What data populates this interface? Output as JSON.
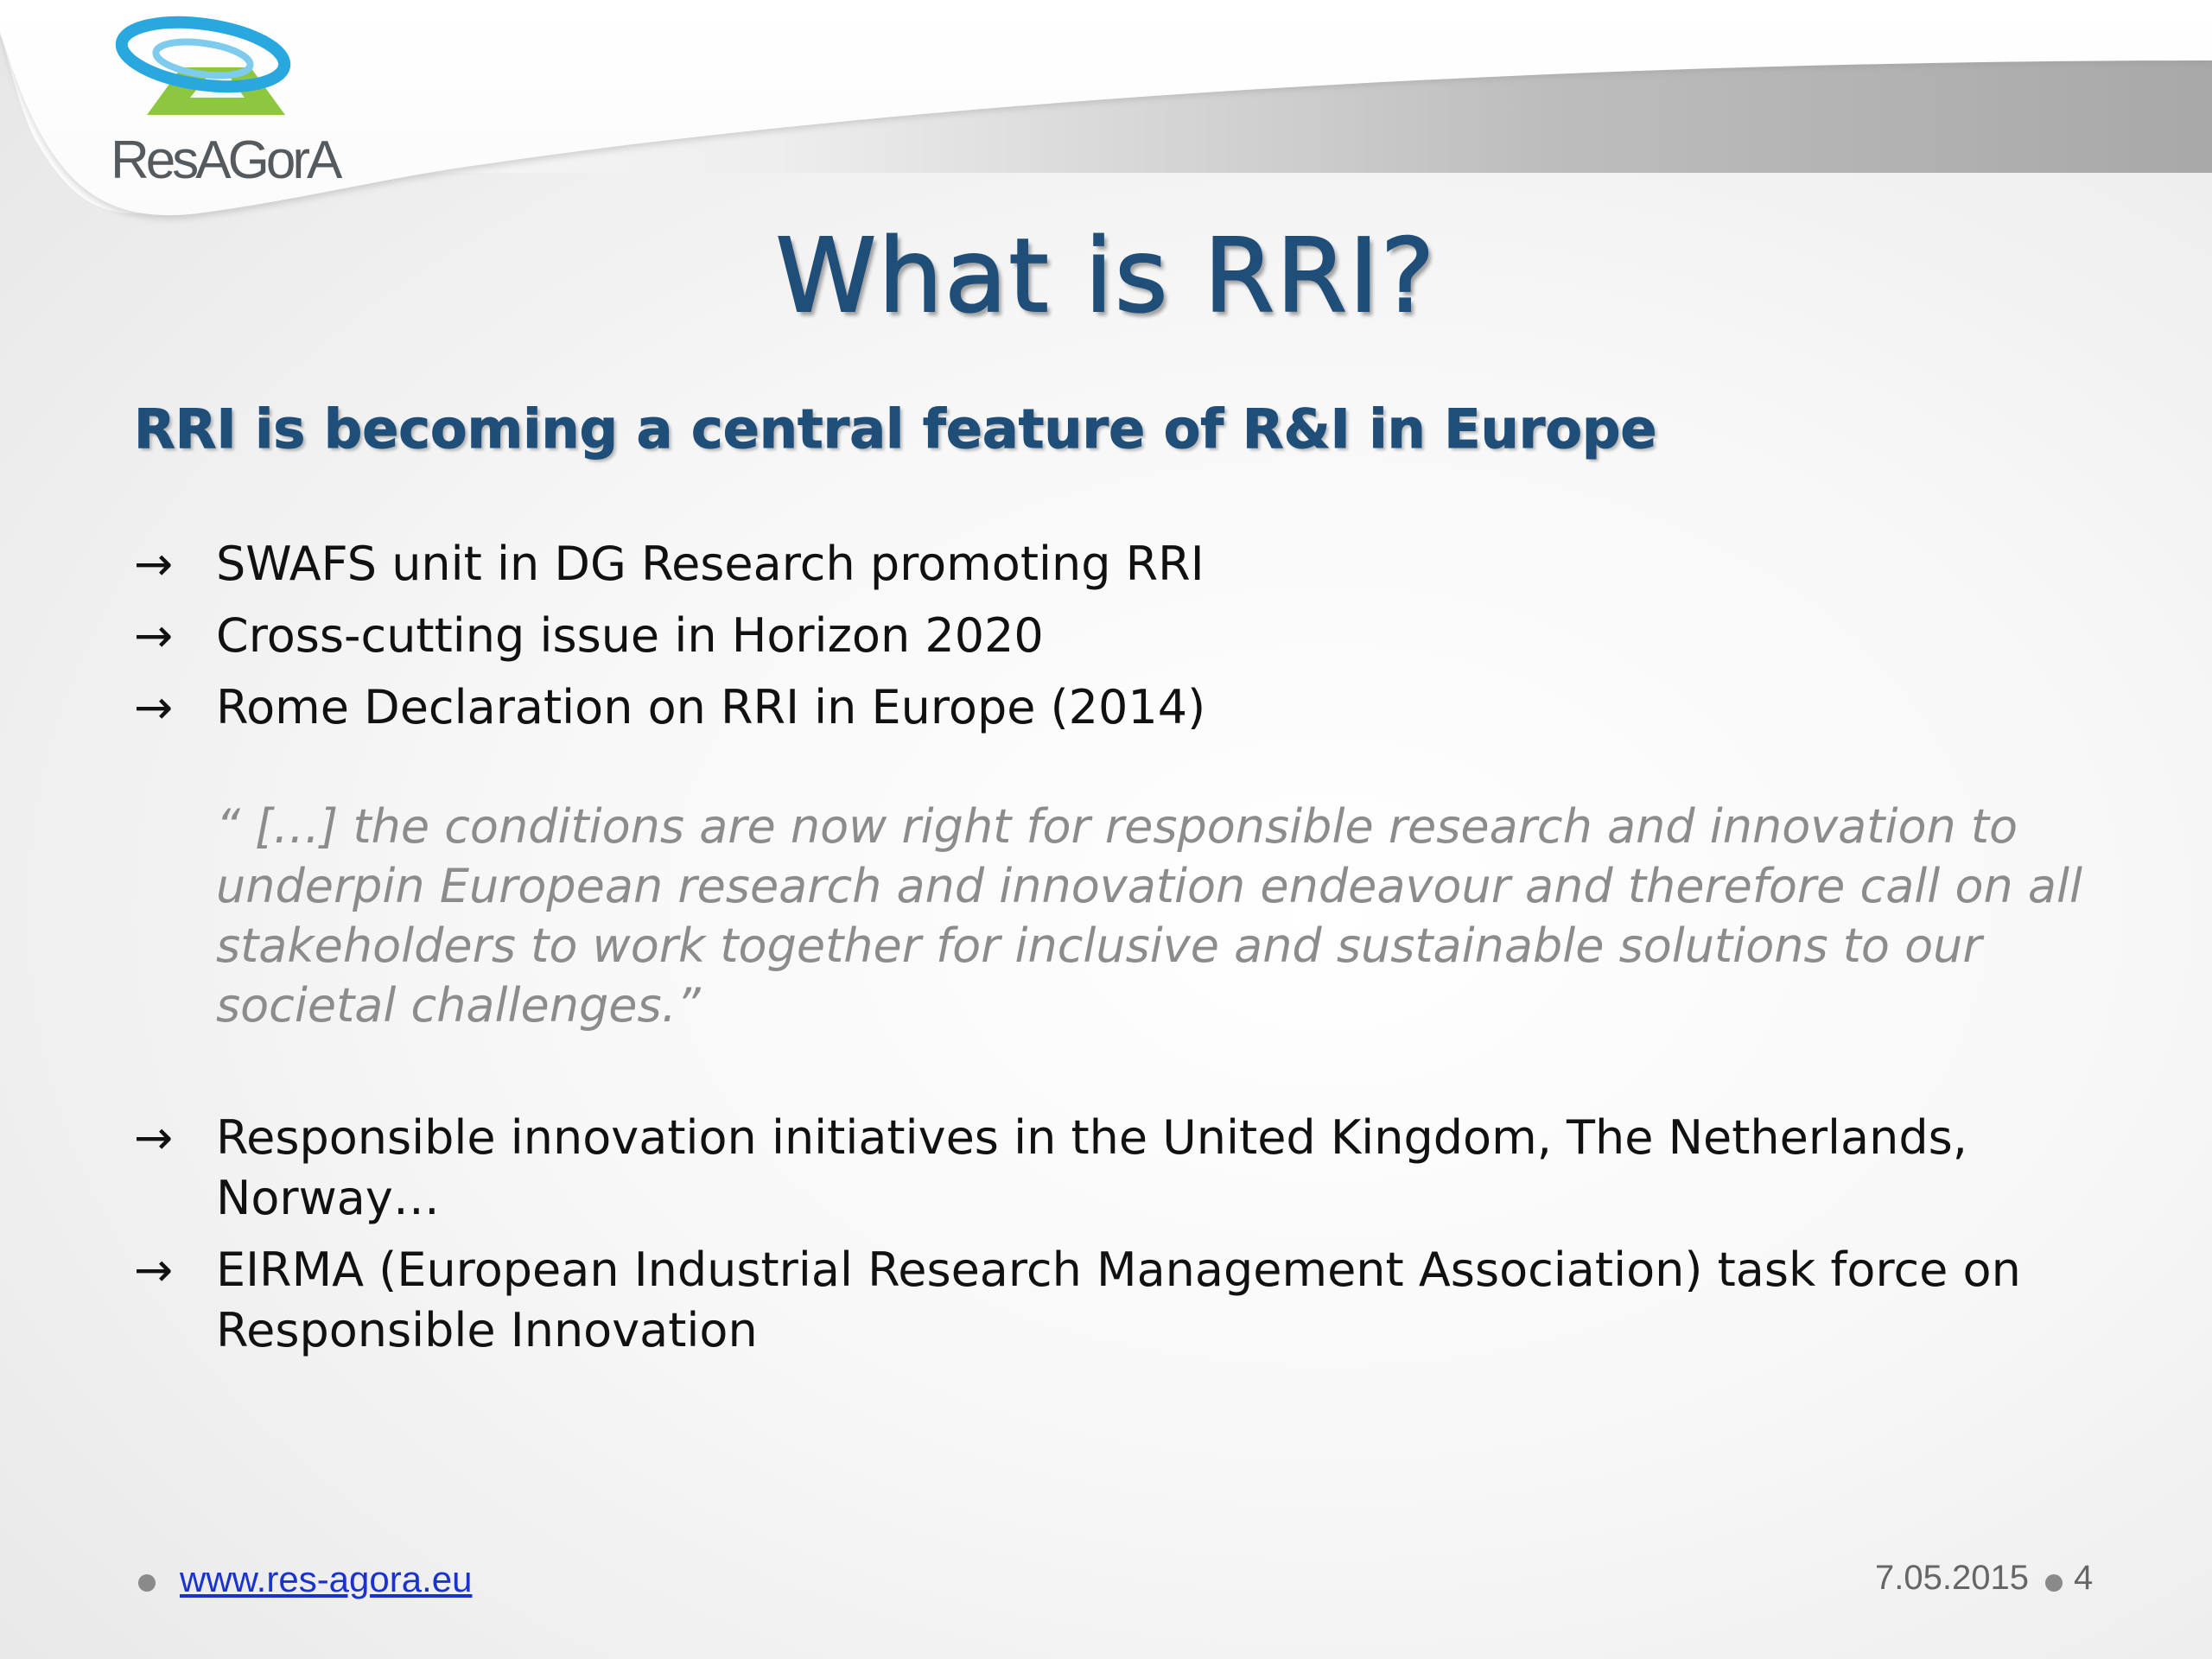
{
  "logo": {
    "text": "ResAGorA",
    "icon": "resagora-logo-icon"
  },
  "slide": {
    "title": "What is RRI?",
    "subtitle": "RRI is becoming a central feature of R&I in Europe",
    "bullets_top": [
      "SWAFS unit in DG Research promoting RRI",
      "Cross-cutting issue in Horizon 2020",
      "Rome Declaration on RRI in Europe (2014)"
    ],
    "quote": " “ […] the conditions are now right for responsible research and innovation to underpin European research and innovation endeavour and therefore call on all stakeholders to work together for inclusive and sustainable solutions to our societal challenges.”",
    "bullets_bottom": [
      "Responsible innovation initiatives in the United Kingdom, The Netherlands, Norway…",
      "EIRMA (European Industrial Research Management Association) task force on Responsible Innovation"
    ],
    "bullet_marker": "→"
  },
  "footer": {
    "link": "www.res-agora.eu",
    "date": "7.05.2015",
    "page": "4"
  },
  "colors": {
    "title": "#1f4e79",
    "quote": "#8c8c8c",
    "link": "#1a33cc",
    "logo_green": "#8dc63f",
    "logo_blue": "#29a8df"
  }
}
